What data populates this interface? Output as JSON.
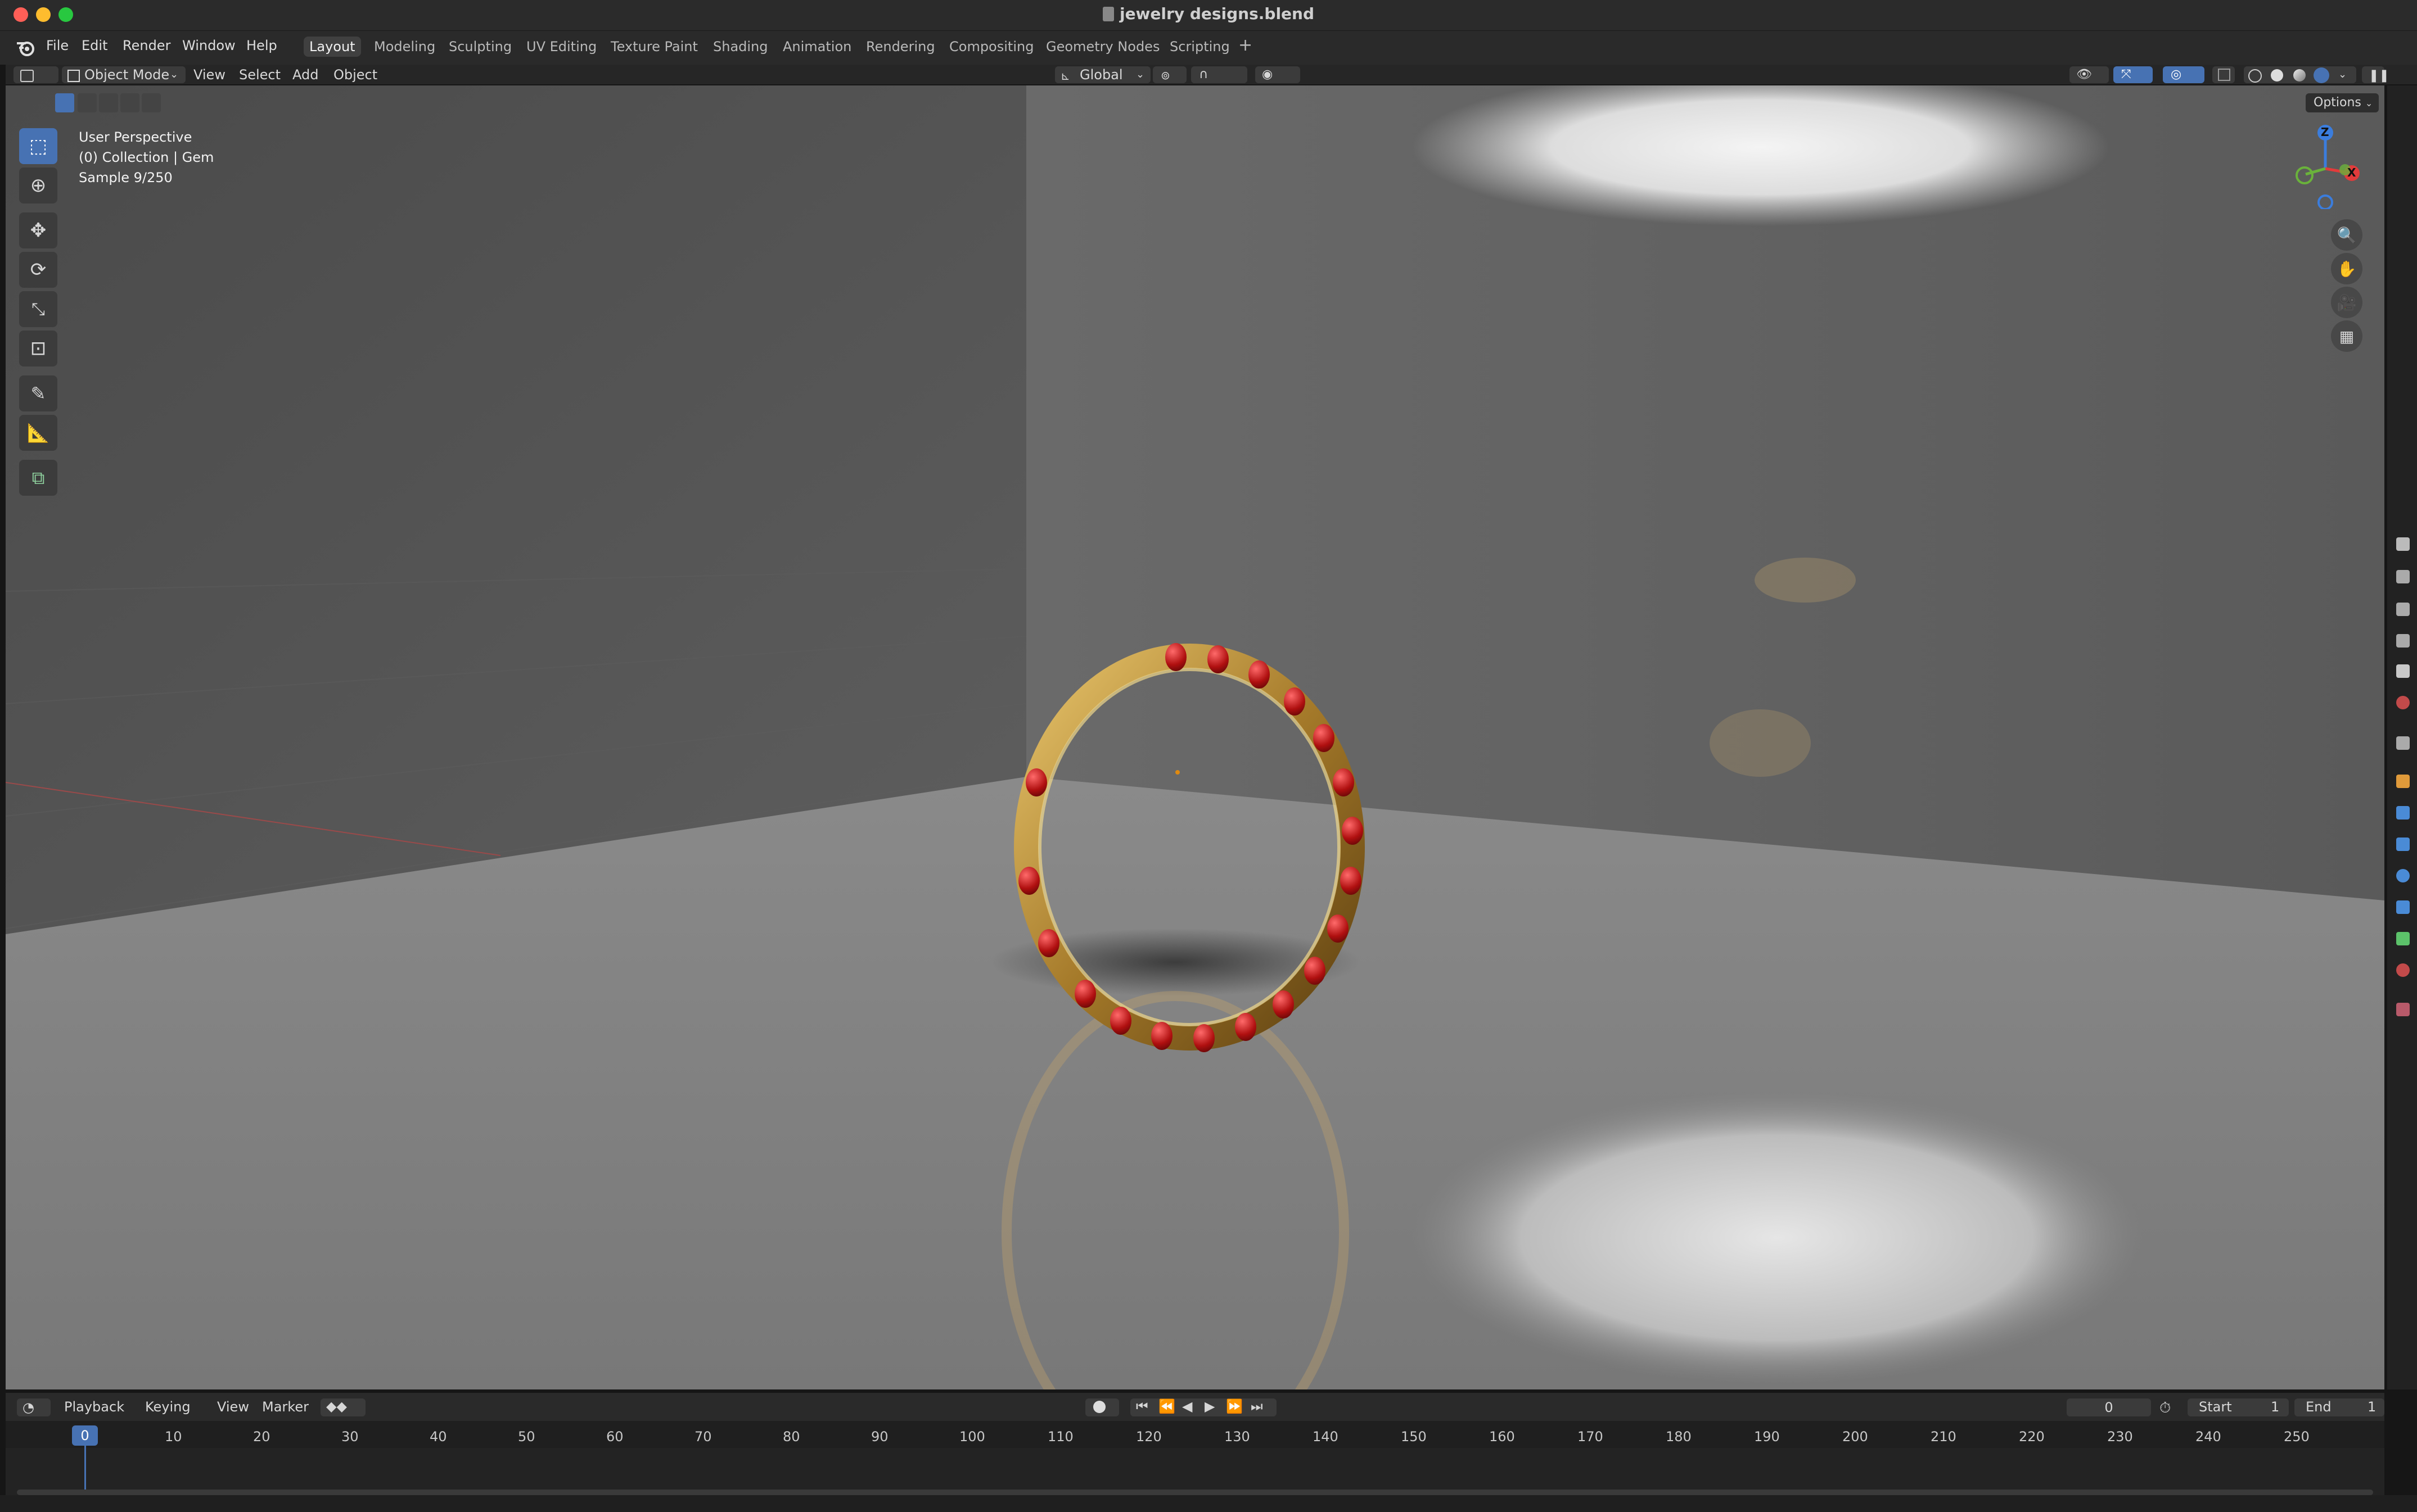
{
  "window": {
    "title": "jewelry designs.blend"
  },
  "menu": [
    "File",
    "Edit",
    "Render",
    "Window",
    "Help"
  ],
  "workspaces": {
    "tabs": [
      "Layout",
      "Modeling",
      "Sculpting",
      "UV Editing",
      "Texture Paint",
      "Shading",
      "Animation",
      "Rendering",
      "Compositing",
      "Geometry Nodes",
      "Scripting"
    ],
    "active": "Layout",
    "add": "+"
  },
  "header": {
    "mode": "Object Mode",
    "menus": [
      "View",
      "Select",
      "Add",
      "Object"
    ],
    "transform_orientation": "Global",
    "options": "Options"
  },
  "viewport": {
    "info_line1": "User Perspective",
    "info_line2": "(0) Collection | Gem",
    "info_line3": "Sample 9/250"
  },
  "gizmo": {
    "z": "Z",
    "y": "Y",
    "x": "X"
  },
  "timeline": {
    "menus": [
      "Playback",
      "Keying",
      "View",
      "Marker"
    ],
    "current_frame": "0",
    "start_label": "Start",
    "start_value": "1",
    "end_label": "End",
    "end_value": "1",
    "playhead_label": "0",
    "ruler": [
      "10",
      "20",
      "30",
      "40",
      "50",
      "60",
      "70",
      "80",
      "90",
      "100",
      "110",
      "120",
      "130",
      "140",
      "150",
      "160",
      "170",
      "180",
      "190",
      "200",
      "210",
      "220",
      "230",
      "240",
      "250"
    ]
  },
  "colors": {
    "accent": "#4772b3",
    "gold": "#b08a3a",
    "gem": "#b01010"
  }
}
